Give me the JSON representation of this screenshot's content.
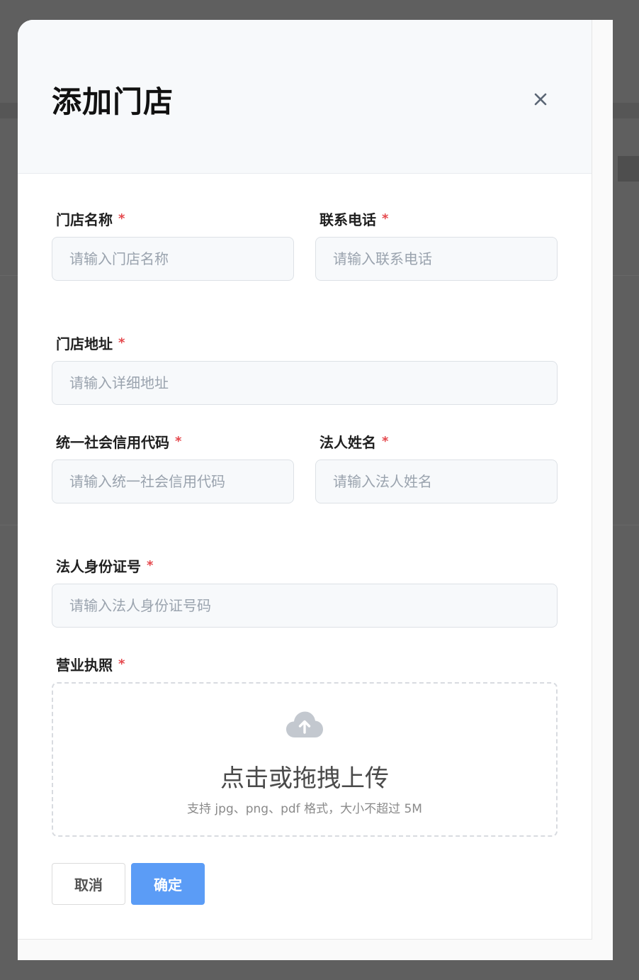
{
  "dialog": {
    "title": "添加门店",
    "close_icon": "close-icon"
  },
  "form": {
    "store_name": {
      "label": "门店名称",
      "required_mark": "*",
      "placeholder": "请输入门店名称",
      "value": ""
    },
    "phone": {
      "label": "联系电话",
      "required_mark": "*",
      "placeholder": "请输入联系电话",
      "value": ""
    },
    "address": {
      "label": "门店地址",
      "required_mark": "*",
      "placeholder": "请输入详细地址",
      "value": ""
    },
    "credit_code": {
      "label": "统一社会信用代码",
      "required_mark": "*",
      "placeholder": "请输入统一社会信用代码",
      "value": ""
    },
    "legal_name": {
      "label": "法人姓名",
      "required_mark": "*",
      "placeholder": "请输入法人姓名",
      "value": ""
    },
    "legal_id": {
      "label": "法人身份证号",
      "required_mark": "*",
      "placeholder": "请输入法人身份证号码",
      "value": ""
    },
    "license": {
      "label": "营业执照",
      "required_mark": "*",
      "upload_icon": "cloud-upload-icon",
      "upload_title": "点击或拖拽上传",
      "upload_hint": "支持 jpg、png、pdf 格式，大小不超过 5M"
    }
  },
  "actions": {
    "cancel_label": "取消",
    "confirm_label": "确定"
  },
  "colors": {
    "primary": "#5b9cf6",
    "required": "#e5484d",
    "header_bg": "#f7f9fb",
    "input_bg": "#f7f9fb"
  }
}
